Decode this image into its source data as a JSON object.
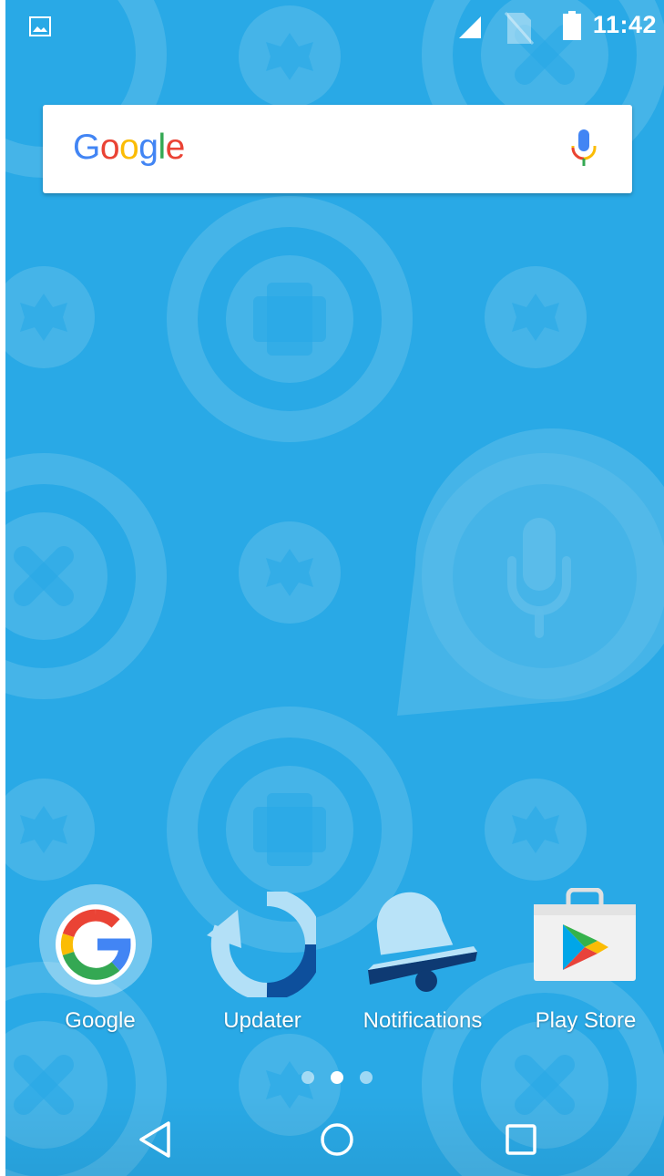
{
  "status_bar": {
    "time": "11:42",
    "icons": [
      "gallery-icon",
      "cell-signal-icon",
      "no-sim-icon",
      "battery-icon"
    ]
  },
  "search": {
    "logo_letters": [
      {
        "char": "G",
        "color": "#4285F4"
      },
      {
        "char": "o",
        "color": "#EA4335"
      },
      {
        "char": "o",
        "color": "#FBBC05"
      },
      {
        "char": "g",
        "color": "#4285F4"
      },
      {
        "char": "l",
        "color": "#34A853"
      },
      {
        "char": "e",
        "color": "#EA4335"
      }
    ],
    "mic_icon": "microphone-icon"
  },
  "apps": [
    {
      "label": "Google",
      "icon": "google-app-icon"
    },
    {
      "label": "Updater",
      "icon": "updater-icon"
    },
    {
      "label": "Notifications",
      "icon": "bell-icon"
    },
    {
      "label": "Play Store",
      "icon": "play-store-icon"
    }
  ],
  "page_indicator": {
    "pages": 3,
    "active_index": 1
  },
  "nav_bar": {
    "buttons": [
      "back-button",
      "home-button",
      "recents-button"
    ]
  },
  "colors": {
    "wallpaper": "#29a9e6",
    "wallpaper_pattern": "#5bbdea",
    "updater_light": "#b3e0f7",
    "updater_dark": "#0d4f9c",
    "bell_light": "#b9e3f8",
    "bell_dark": "#0e3a73"
  }
}
